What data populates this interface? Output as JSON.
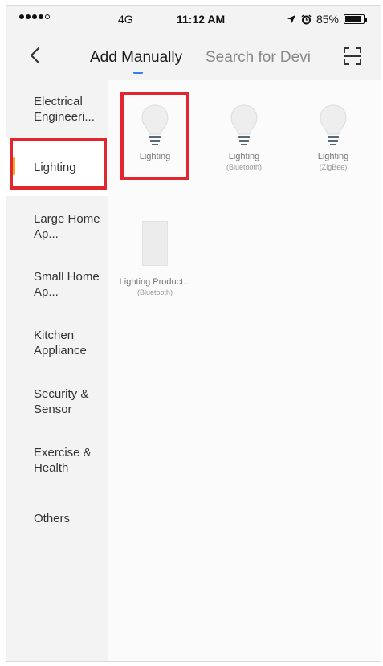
{
  "status_bar": {
    "signal_dots": 5,
    "carrier": "4G",
    "time": "11:12 AM",
    "battery": "85%",
    "battery_level": 0.85
  },
  "nav": {
    "back_icon": "chevron-left-icon",
    "tabs": [
      {
        "label": "Add Manually",
        "active": true
      },
      {
        "label": "Search for Devi",
        "active": false
      }
    ],
    "scan_icon": "scan-icon",
    "accent": "#2f80ed"
  },
  "sidebar": {
    "items": [
      {
        "label": "Electrical Engineeri..."
      },
      {
        "label": "Lighting"
      },
      {
        "label": "Large Home Ap..."
      },
      {
        "label": "Small Home Ap..."
      },
      {
        "label": "Kitchen Appliance"
      },
      {
        "label": "Security & Sensor"
      },
      {
        "label": "Exercise & Health"
      },
      {
        "label": "Others"
      }
    ],
    "selected_index": 1,
    "selected_color": "#f5a623"
  },
  "devices": [
    {
      "label": "Lighting",
      "sub": "",
      "icon": "bulb-icon"
    },
    {
      "label": "Lighting",
      "sub": "(Bluetooth)",
      "icon": "bulb-icon"
    },
    {
      "label": "Lighting",
      "sub": "(ZigBee)",
      "icon": "bulb-icon"
    },
    {
      "label": "Lighting Product...",
      "sub": "(Bluetooth)",
      "icon": "light-panel-icon"
    }
  ],
  "highlight_color": "#e0262e"
}
